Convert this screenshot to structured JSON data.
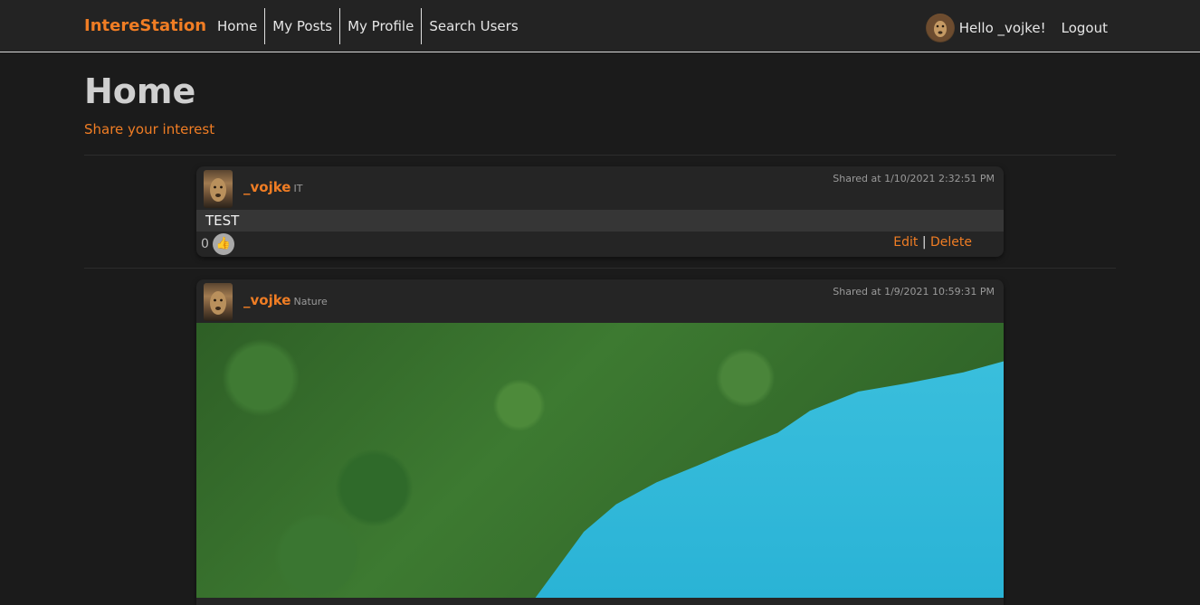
{
  "nav": {
    "brand": "IntereStation",
    "links": [
      "Home",
      "My Posts",
      "My Profile",
      "Search Users"
    ],
    "greeting": "Hello _vojke!",
    "logout": "Logout"
  },
  "page": {
    "title": "Home",
    "subtitle": "Share your interest"
  },
  "posts": [
    {
      "username": "_vojke",
      "category": "IT",
      "shared": "Shared at 1/10/2021 2:32:51 PM",
      "body": "TEST",
      "likes": "0",
      "edit": "Edit",
      "separator": "|",
      "delete": "Delete"
    },
    {
      "username": "_vojke",
      "category": "Nature",
      "shared": "Shared at 1/9/2021 10:59:31 PM"
    }
  ],
  "icons": {
    "like": "thumbs-up-icon",
    "avatar": "user-avatar-lion"
  },
  "colors": {
    "accent": "#f07d24",
    "background": "#1b1b1b",
    "navbar": "#232323",
    "card": "#252525"
  }
}
